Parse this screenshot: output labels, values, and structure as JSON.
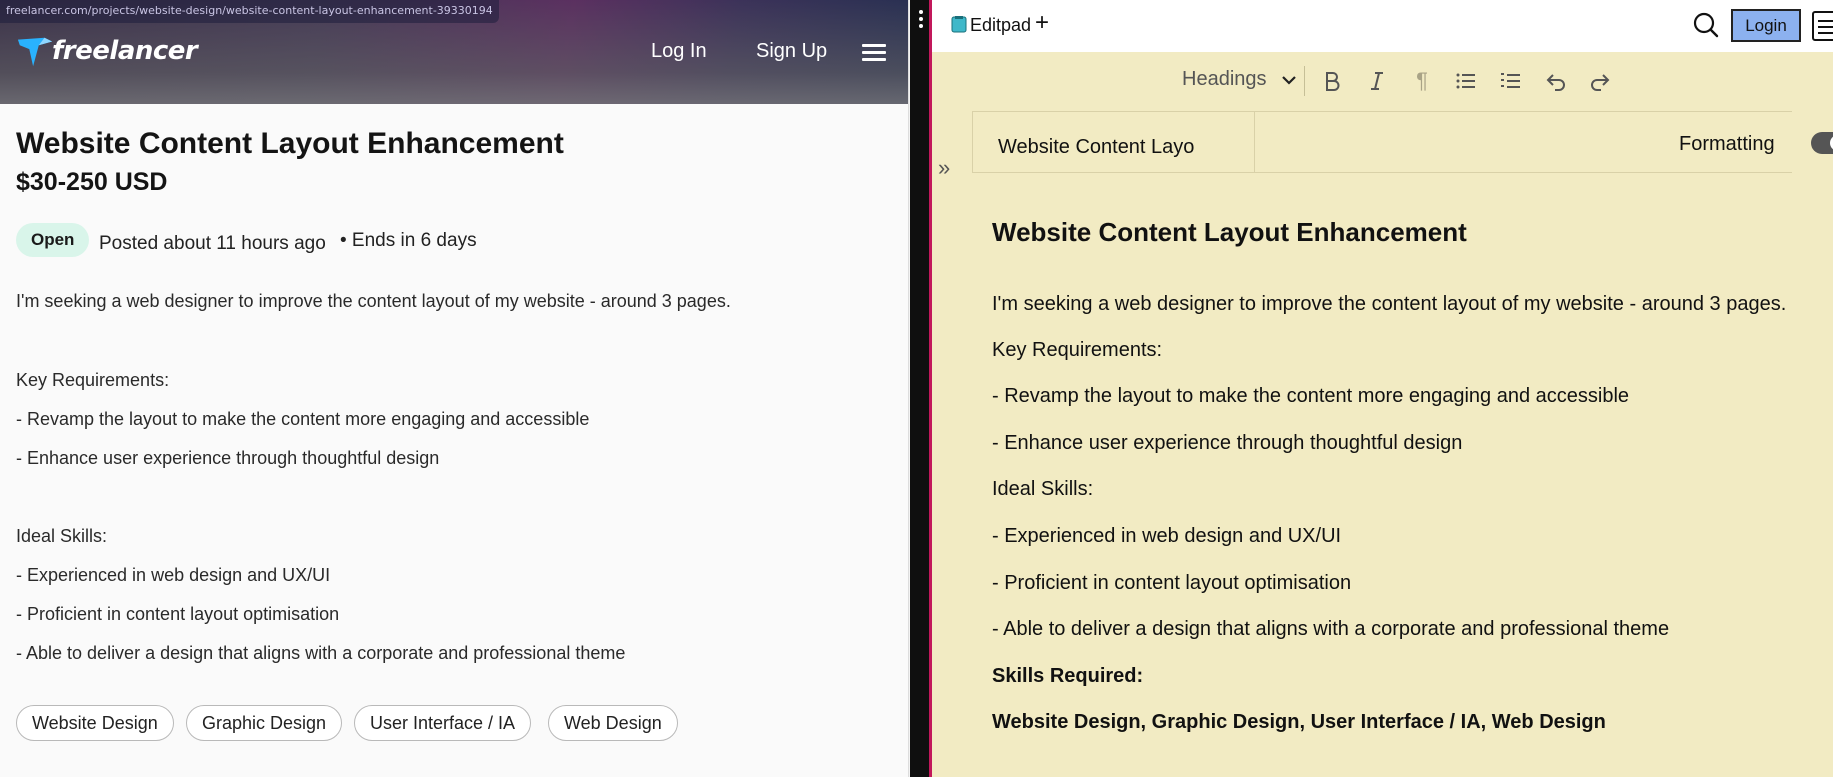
{
  "left": {
    "url": "freelancer.com/projects/website-design/website-content-layout-enhancement-39330194",
    "brand": "freelancer",
    "nav": {
      "login": "Log In",
      "signup": "Sign Up"
    },
    "project": {
      "title": "Website Content Layout Enhancement",
      "budget": "$30-250 USD",
      "status": "Open",
      "posted": "Posted about 11 hours ago",
      "ends": "• Ends in 6 days",
      "description": [
        "I'm seeking a web designer to improve the content layout of my website - around 3 pages.",
        "Key Requirements:",
        "- Revamp the layout to make the content more engaging and accessible",
        "- Enhance user experience through thoughtful design",
        "Ideal Skills:",
        "- Experienced in web design and UX/UI",
        "- Proficient in content layout optimisation",
        "- Able to deliver a design that aligns with a corporate and professional theme"
      ],
      "skills": [
        "Website Design",
        "Graphic Design",
        "User Interface / IA",
        "Web Design"
      ]
    },
    "colors": {
      "status_badge_bg": "#d9f5ea",
      "brand_blue": "#29b2fe"
    }
  },
  "right": {
    "app_title": "Editpad",
    "new_label": "+",
    "login_label": "Login",
    "toolbar": {
      "headings_label": "Headings",
      "buttons": [
        "bold-icon",
        "italic-icon",
        "paragraph-icon",
        "bullet-list-icon",
        "numbered-list-icon",
        "undo-icon",
        "redo-icon"
      ]
    },
    "tab_label": "Website Content Layo",
    "formatting_label": "Formatting",
    "formatting_on": true,
    "collapse_label": "»",
    "document": {
      "heading": "Website Content Layout Enhancement",
      "lines": [
        "I'm seeking a web designer to improve the content layout of my website - around 3 pages.",
        "Key Requirements:",
        "- Revamp the layout to make the content more engaging and accessible",
        "- Enhance user experience through thoughtful design",
        "Ideal Skills:",
        "- Experienced in web design and UX/UI",
        "- Proficient in content layout optimisation",
        "- Able to deliver a design that aligns with a corporate and professional theme"
      ],
      "skills_heading": "Skills Required:",
      "skills_line": "Website Design, Graphic Design, User Interface / IA, Web Design"
    },
    "colors": {
      "background": "#f2ebc3",
      "login_button": "#8cb1ef"
    }
  }
}
